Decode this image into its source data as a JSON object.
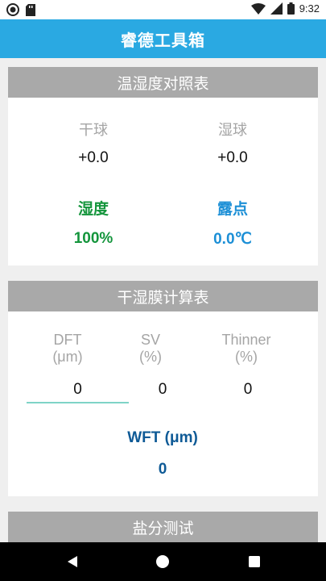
{
  "status_bar": {
    "time": "9:32"
  },
  "app_bar": {
    "title": "睿德工具箱"
  },
  "humidity_card": {
    "title": "温湿度对照表",
    "dry_bulb_label": "干球",
    "wet_bulb_label": "湿球",
    "dry_bulb_value": "+0.0",
    "wet_bulb_value": "+0.0",
    "humidity_label": "湿度",
    "dew_point_label": "露点",
    "humidity_value": "100%",
    "dew_point_value": "0.0℃",
    "colors": {
      "humidity": "#14953c",
      "dew_point": "#1c8fd6"
    }
  },
  "film_card": {
    "title": "干湿膜计算表",
    "dft_label_line1": "DFT",
    "dft_label_line2": "(μm)",
    "sv_label_line1": "SV",
    "sv_label_line2": "(%)",
    "thinner_label_line1": "Thinner",
    "thinner_label_line2": "(%)",
    "dft_value": "0",
    "sv_value": "0",
    "thinner_value": "0",
    "wft_label": "WFT (μm)",
    "wft_value": "0"
  },
  "salt_card": {
    "title": "盐分测试"
  },
  "theme": {
    "primary": "#2aa9e2",
    "header_grey": "#a9a9a9",
    "input_underline": "#7fd4c7"
  }
}
